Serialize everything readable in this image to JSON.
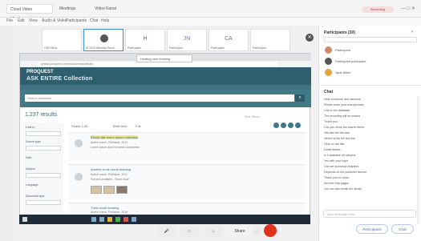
{
  "browser": {
    "tabs": [
      "Cloud Video Meetings",
      "Meetings",
      "Video Kanal"
    ],
    "menu": [
      "File",
      "Edit",
      "View",
      "Audio & Video",
      "Participants",
      "Chat",
      "Help"
    ],
    "record_label": "Recording"
  },
  "stage": {
    "thumbnails": [
      {
        "initial": "",
        "name": "ORIGINAL"
      },
      {
        "initial": "",
        "name": "ACCES Meeting Room"
      },
      {
        "initial": "H",
        "name": "Participant"
      },
      {
        "initial": "JN",
        "name": "Participant"
      },
      {
        "initial": "CA",
        "name": "Participant"
      },
      {
        "initial": "",
        "name": "Participant"
      }
    ],
    "popup": "Hosting new meeting"
  },
  "shared_screen": {
    "address": "search.proquest.com/ebookcentral/results",
    "banner_title": "PROQUEST",
    "banner_subtitle": "ASK ENTIRE Collection",
    "search_placeholder": "Search database",
    "results_count": "1,237 results",
    "results_tools": "Sort  Show",
    "facets": [
      "Limit to",
      "Source type",
      "Date",
      "Subject",
      "Language",
      "Document type"
    ],
    "toolbar": [
      "Select 1-20",
      "Brief view",
      "Full"
    ],
    "results": [
      {
        "title": "Ebook title lorem ipsum collection",
        "meta": "Author name, Publisher, 2019",
        "snippet": "Lorem ipsum dolor sit amet consectetur"
      },
      {
        "title": "Another book result heading",
        "meta": "Author name, Publisher, 2017",
        "snippet": "Full text available - Show more"
      },
      {
        "title": "Third result heading",
        "meta": "Author name, Publisher, 2015",
        "snippet": "Abstract preview text"
      }
    ]
  },
  "controls": {
    "share": "Share",
    "more": "..."
  },
  "panel": {
    "participants_title": "Participants (30)",
    "participants": [
      "Participant",
      "Participant participant",
      "Jane Miller"
    ],
    "chat_title": "Chat",
    "chat_lines": [
      "Hello everyone and welcome",
      "Please mute your microphones",
      "Link to the database",
      "The recording will be shared",
      "Thank you",
      "Can you show the search filters",
      "Yes see the left side",
      "Where is the full text link",
      "Click on the title",
      "Great thanks",
      "Is it available off campus",
      "Yes with your login",
      "Can we download chapters",
      "Depends on the publisher license",
      "Thank you so much",
      "See the help pages",
      "You can also email the library"
    ],
    "chat_placeholder": "Type message here...",
    "btn_participants": "Participants",
    "btn_chat": "Chat"
  },
  "colors": {
    "banner": "#2f5f6e",
    "end_call": "#e0301e",
    "accent": "#3a8ed9"
  }
}
